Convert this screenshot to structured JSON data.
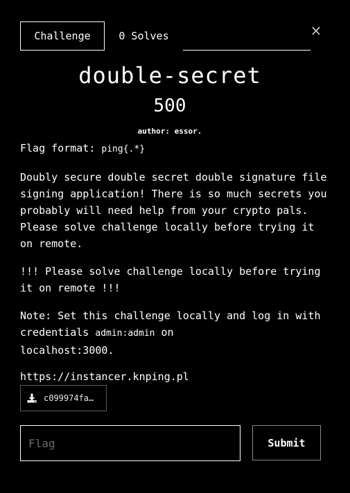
{
  "tabs": {
    "challenge_label": "Challenge",
    "solves_label": "0 Solves"
  },
  "close_glyph": "×",
  "challenge": {
    "name": "double-secret",
    "value": "500",
    "author": "author: essor.",
    "flag_format_prefix": "Flag format: ",
    "flag_format_code": "ping{.*}",
    "paragraph_1": "Doubly secure double secret double signature file signing application! There is so much secrets you probably will need help from your crypto pals. Please solve challenge locally before trying it on remote.",
    "paragraph_2": "!!! Please solve challenge locally before trying it on remote !!!",
    "note_prefix": "Note: Set this challenge locally and log in with credentials ",
    "note_credentials": "admin:admin",
    "note_middle": " on",
    "note_host": "localhost:3000.",
    "instancer_link": "https://instancer.knping.pl"
  },
  "file": {
    "name": "c099974fa…",
    "icon": "download-icon"
  },
  "form": {
    "flag_placeholder": "Flag",
    "submit_label": "Submit"
  }
}
